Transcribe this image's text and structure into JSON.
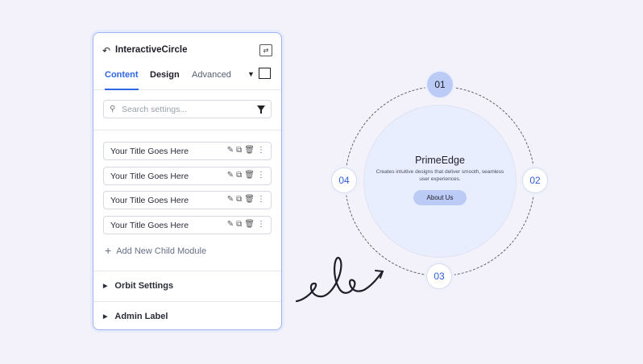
{
  "panel": {
    "title": "InteractiveCircle",
    "tabs": [
      {
        "label": "Content"
      },
      {
        "label": "Design"
      },
      {
        "label": "Advanced"
      }
    ],
    "search_placeholder": "Search settings...",
    "items": [
      {
        "label": "Your Title Goes Here"
      },
      {
        "label": "Your Title Goes Here"
      },
      {
        "label": "Your Title Goes Here"
      },
      {
        "label": "Your Title Goes Here"
      }
    ],
    "add_child_label": "Add New Child Module",
    "sections": [
      {
        "label": "Orbit Settings"
      },
      {
        "label": "Admin Label"
      }
    ]
  },
  "orbit": {
    "title": "PrimeEdge",
    "description": "Creates intuitive designs that deliver smooth, seamless user experiences.",
    "button_label": "About Us",
    "nodes": [
      "01",
      "02",
      "03",
      "04"
    ],
    "active_node": "01"
  },
  "colors": {
    "accent": "#2f66e6",
    "node_active": "#bccbf6",
    "inner_circle": "#e8eefe",
    "background": "#f3f2fb"
  }
}
